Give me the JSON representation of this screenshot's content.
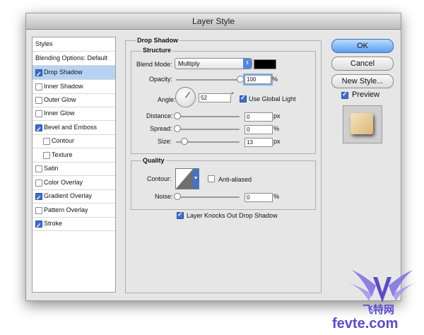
{
  "window": {
    "title": "Layer Style"
  },
  "sidebar": {
    "items": [
      {
        "label": "Styles",
        "checkbox": false
      },
      {
        "label": "Blending Options: Default",
        "checkbox": false
      },
      {
        "label": "Drop Shadow",
        "checkbox": true,
        "checked": true,
        "selected": true
      },
      {
        "label": "Inner Shadow",
        "checkbox": true,
        "checked": false
      },
      {
        "label": "Outer Glow",
        "checkbox": true,
        "checked": false
      },
      {
        "label": "Inner Glow",
        "checkbox": true,
        "checked": false
      },
      {
        "label": "Bevel and Emboss",
        "checkbox": true,
        "checked": true
      },
      {
        "label": "Contour",
        "checkbox": true,
        "checked": false,
        "sub": true
      },
      {
        "label": "Texture",
        "checkbox": true,
        "checked": false,
        "sub": true
      },
      {
        "label": "Satin",
        "checkbox": true,
        "checked": false
      },
      {
        "label": "Color Overlay",
        "checkbox": true,
        "checked": false
      },
      {
        "label": "Gradient Overlay",
        "checkbox": true,
        "checked": true
      },
      {
        "label": "Pattern Overlay",
        "checkbox": true,
        "checked": false
      },
      {
        "label": "Stroke",
        "checkbox": true,
        "checked": true
      }
    ]
  },
  "drop_shadow": {
    "heading": "Drop Shadow",
    "structure": {
      "heading": "Structure",
      "blend_mode_label": "Blend Mode:",
      "blend_mode_value": "Multiply",
      "shadow_color": "#000000",
      "opacity_label": "Opacity:",
      "opacity_value": "100",
      "opacity_unit": "%",
      "angle_label": "Angle:",
      "angle_value": "52",
      "angle_unit": "°",
      "use_global_light_label": "Use Global Light",
      "use_global_light_checked": true,
      "distance_label": "Distance:",
      "distance_value": "0",
      "distance_unit": "px",
      "spread_label": "Spread:",
      "spread_value": "0",
      "spread_unit": "%",
      "size_label": "Size:",
      "size_value": "13",
      "size_unit": "px"
    },
    "quality": {
      "heading": "Quality",
      "contour_label": "Contour:",
      "anti_aliased_label": "Anti-aliased",
      "anti_aliased_checked": false,
      "noise_label": "Noise:",
      "noise_value": "0",
      "noise_unit": "%"
    },
    "knockout_label": "Layer Knocks Out Drop Shadow",
    "knockout_checked": true
  },
  "buttons": {
    "ok": "OK",
    "cancel": "Cancel",
    "new_style": "New Style..."
  },
  "preview": {
    "label": "Preview",
    "checked": true
  },
  "watermark": {
    "text_cn": "飞特网",
    "text_url": "fevte.com"
  },
  "colors": {
    "accent": "#3a6fd0",
    "selection": "#b7d3f3",
    "watermark": "#6a5bd8"
  }
}
